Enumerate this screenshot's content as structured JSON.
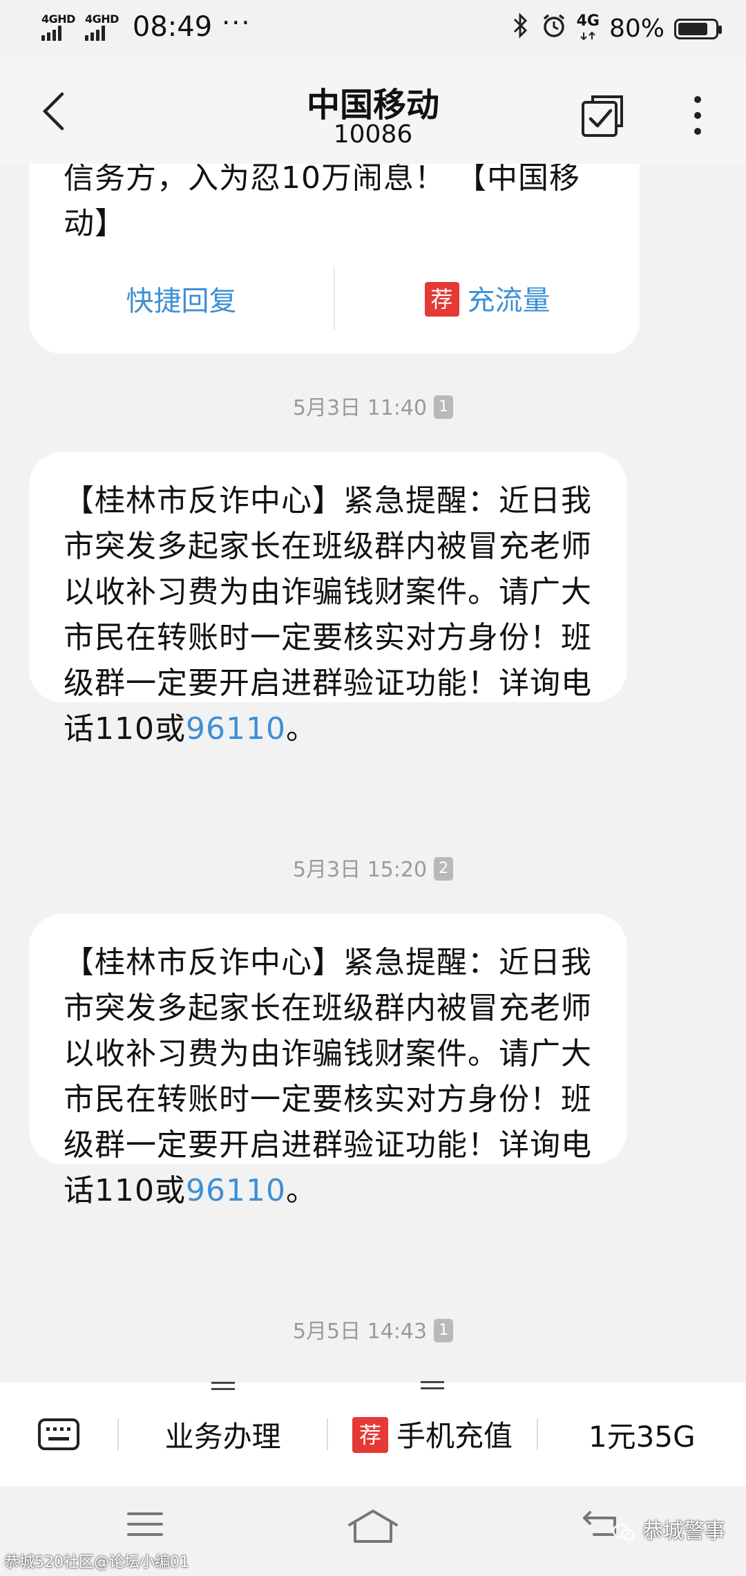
{
  "status_bar": {
    "sim1_tag": "4GHD",
    "sim2_tag": "4GHD",
    "time": "08:49",
    "dots": "···",
    "network_tag": "4G",
    "battery_percent": "80%",
    "battery_level": 0.8
  },
  "header": {
    "title": "中国移动",
    "number": "10086"
  },
  "messages": {
    "first_partial": {
      "text_line1": "信务方，入为忍10万闹息！ 【中国移",
      "text_line2": "动】",
      "quick_reply": "快捷回复",
      "recommend_badge": "荐",
      "recharge_data": "充流量"
    },
    "ts1": {
      "text": "5月3日 11:40",
      "sim": "1"
    },
    "msg1": {
      "text": "【桂林市反诈中心】紧急提醒：近日我市突发多起家长在班级群内被冒充老师以收补习费为由诈骗钱财案件。请广大市民在转账时一定要核实对方身份！班级群一定要开启进群验证功能！详询电话110或",
      "link": "96110",
      "tail": "。"
    },
    "ts2": {
      "text": "5月3日 15:20",
      "sim": "2"
    },
    "msg2": {
      "text": "【桂林市反诈中心】紧急提醒：近日我市突发多起家长在班级群内被冒充老师以收补习费为由诈骗钱财案件。请广大市民在转账时一定要核实对方身份！班级群一定要开启进群验证功能！详询电话110或",
      "link": "96110",
      "tail": "。"
    },
    "ts3": {
      "text": "5月5日 14:43",
      "sim": "1"
    }
  },
  "menu": {
    "item1": "业务办理",
    "recommend_badge": "荐",
    "item2": "手机充值",
    "item3": "1元35G"
  },
  "watermarks": {
    "right": "恭城警事",
    "left": "恭城520社区@论坛小编01"
  }
}
